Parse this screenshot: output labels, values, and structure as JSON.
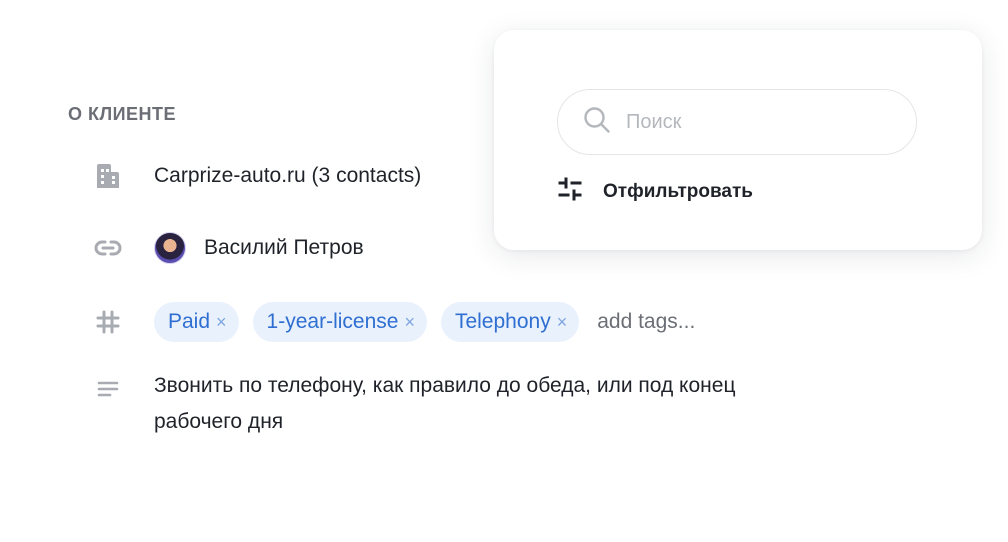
{
  "section": {
    "title": "О КЛИЕНТЕ"
  },
  "company": {
    "icon": "building-icon",
    "label": "Carprize-auto.ru (3 contacts)"
  },
  "contact": {
    "icon": "link-icon",
    "name": "Василий Петров"
  },
  "tags": {
    "icon": "hash-icon",
    "items": [
      {
        "label": "Paid"
      },
      {
        "label": "1-year-license"
      },
      {
        "label": "Telephony"
      }
    ],
    "remove_glyph": "×",
    "add_placeholder": "add tags..."
  },
  "note": {
    "icon": "text-lines-icon",
    "text": "Звонить по телефону, как правило до обеда, или под конец рабочего дня"
  },
  "popover": {
    "search": {
      "icon": "search-icon",
      "placeholder": "Поиск",
      "value": ""
    },
    "filter": {
      "icon": "filter-sliders-icon",
      "label": "Отфильтровать"
    }
  },
  "colors": {
    "tag_bg": "#e9f1fd",
    "tag_text": "#2f6fd1",
    "muted": "#6b6f75",
    "icon": "#a8acb2"
  }
}
